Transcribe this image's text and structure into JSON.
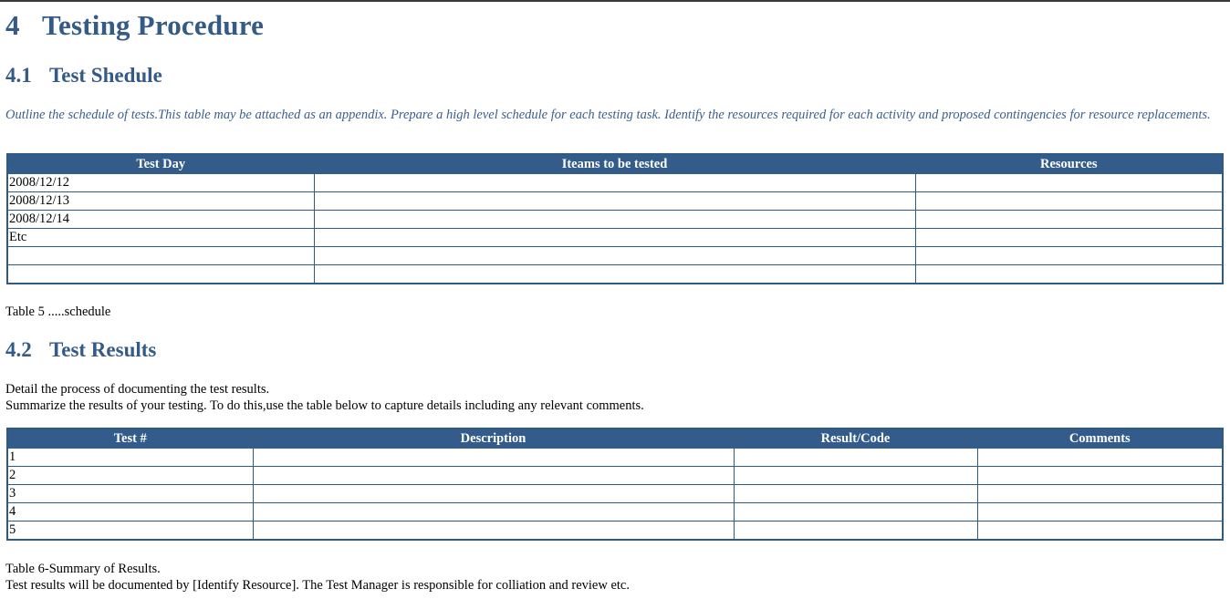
{
  "heading1": {
    "number": "4",
    "text": "Testing Procedure"
  },
  "section_schedule": {
    "number": "4.1",
    "title": "Test Shedule",
    "note": "Outline the schedule of tests.This table may be attached as an appendix. Prepare a high level schedule for each testing task. Identify the resources required for each activity and proposed contingencies for resource replacements.",
    "table": {
      "headers": [
        "Test Day",
        "Iteams to be tested",
        "Resources"
      ],
      "rows": [
        [
          "2008/12/12",
          "",
          ""
        ],
        [
          "2008/12/13",
          "",
          ""
        ],
        [
          "2008/12/14",
          "",
          ""
        ],
        [
          "Etc",
          "",
          ""
        ],
        [
          "",
          "",
          ""
        ],
        [
          "",
          "",
          ""
        ]
      ]
    },
    "caption": "Table 5 .....schedule"
  },
  "section_results": {
    "number": "4.2",
    "title": "Test Results",
    "para_line1": "Detail the process of documenting the test results.",
    "para_line2": "Summarize the results of your testing. To do this,use the table below to capture details including any relevant comments.",
    "table": {
      "headers": [
        "Test #",
        "Description",
        "Result/Code",
        "Comments"
      ],
      "rows": [
        [
          "1",
          "",
          "",
          ""
        ],
        [
          "2",
          "",
          "",
          ""
        ],
        [
          "3",
          "",
          "",
          ""
        ],
        [
          "4",
          "",
          "",
          ""
        ],
        [
          "5",
          "",
          "",
          ""
        ]
      ]
    },
    "caption": "Table 6-Summary of Results.",
    "footer_text": "Test results will be documented by [Identify Resource]. The Test Manager is responsible for colliation and review etc."
  }
}
